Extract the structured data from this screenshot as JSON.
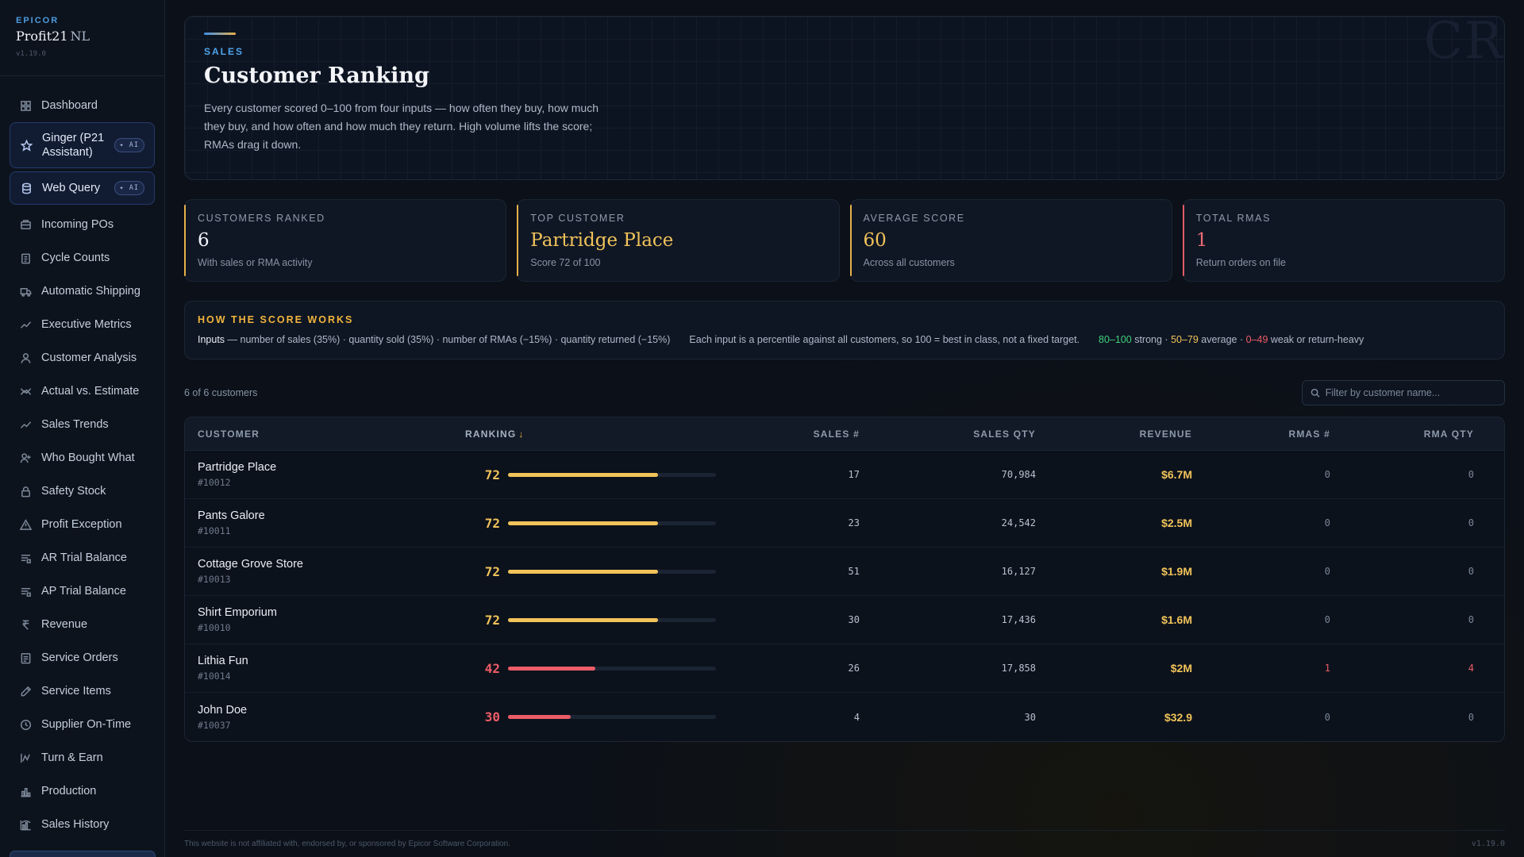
{
  "brand": {
    "vendor": "EPICOR",
    "name": "Profit21",
    "suffix": "NL",
    "version": "v1.19.0"
  },
  "sidebar": {
    "items": [
      {
        "label": "Dashboard",
        "icon": "dashboard-icon"
      },
      {
        "label": "Ginger (P21 Assistant)",
        "icon": "star-icon",
        "badge": "✦ AI"
      },
      {
        "label": "Web Query",
        "icon": "database-icon",
        "badge": "✦ AI"
      },
      {
        "label": "Incoming POs",
        "icon": "inbox-icon"
      },
      {
        "label": "Cycle Counts",
        "icon": "clipboard-icon"
      },
      {
        "label": "Automatic Shipping",
        "icon": "truck-icon"
      },
      {
        "label": "Executive Metrics",
        "icon": "trend-icon"
      },
      {
        "label": "Customer Analysis",
        "icon": "user-icon"
      },
      {
        "label": "Actual vs. Estimate",
        "icon": "compare-icon"
      },
      {
        "label": "Sales Trends",
        "icon": "trend-icon"
      },
      {
        "label": "Who Bought What",
        "icon": "user-plus-icon"
      },
      {
        "label": "Safety Stock",
        "icon": "lock-icon"
      },
      {
        "label": "Profit Exception",
        "icon": "warning-icon"
      },
      {
        "label": "AR Trial Balance",
        "icon": "ledger-icon"
      },
      {
        "label": "AP Trial Balance",
        "icon": "ledger-icon"
      },
      {
        "label": "Revenue",
        "icon": "currency-icon"
      },
      {
        "label": "Service Orders",
        "icon": "document-icon"
      },
      {
        "label": "Service Items",
        "icon": "pen-icon"
      },
      {
        "label": "Supplier On-Time",
        "icon": "clock-icon"
      },
      {
        "label": "Turn & Earn",
        "icon": "cycle-chart-icon"
      },
      {
        "label": "Production",
        "icon": "bar-chart-icon"
      },
      {
        "label": "Sales History",
        "icon": "history-chart-icon"
      }
    ]
  },
  "hero": {
    "kicker": "SALES",
    "title": "Customer Ranking",
    "description": "Every customer scored 0–100 from four inputs — how often they buy, how much they buy, and how often and how much they return. High volume lifts the score; RMAs drag it down.",
    "watermark": "CR"
  },
  "kpis": [
    {
      "label": "CUSTOMERS RANKED",
      "value": "6",
      "sub": "With sales or RMA activity"
    },
    {
      "label": "TOP CUSTOMER",
      "value": "Partridge Place",
      "sub": "Score 72 of 100"
    },
    {
      "label": "AVERAGE SCORE",
      "value": "60",
      "sub": "Across all customers"
    },
    {
      "label": "TOTAL RMAS",
      "value": "1",
      "sub": "Return orders on file"
    }
  ],
  "howto": {
    "title": "HOW THE SCORE WORKS",
    "inputs_label": "Inputs",
    "inputs_text": " — number of sales (35%) · quantity sold (35%) · number of RMAs (−15%) · quantity returned (−15%)",
    "note": "Each input is a percentile against all customers, so 100 = best in class, not a fixed target.",
    "legend": {
      "strong_range": "80–100",
      "strong_text": " strong · ",
      "avg_range": "50–79",
      "avg_text": " average · ",
      "weak_range": "0–49",
      "weak_text": " weak or return-heavy"
    }
  },
  "toolbar": {
    "count": "6 of 6 customers",
    "search_placeholder": "Filter by customer name..."
  },
  "table": {
    "headers": {
      "customer": "CUSTOMER",
      "ranking": "RANKING",
      "ranking_arrow": "↓",
      "sales": "SALES #",
      "qty": "SALES QTY",
      "revenue": "REVENUE",
      "rmas": "RMAS #",
      "rmaqty": "RMA QTY"
    },
    "rows": [
      {
        "name": "Partridge Place",
        "id": "#10012",
        "score": 72,
        "sales": "17",
        "qty": "70,984",
        "revenue": "$6.7M",
        "rmas": "0",
        "rmaqty": "0"
      },
      {
        "name": "Pants Galore",
        "id": "#10011",
        "score": 72,
        "sales": "23",
        "qty": "24,542",
        "revenue": "$2.5M",
        "rmas": "0",
        "rmaqty": "0"
      },
      {
        "name": "Cottage Grove Store",
        "id": "#10013",
        "score": 72,
        "sales": "51",
        "qty": "16,127",
        "revenue": "$1.9M",
        "rmas": "0",
        "rmaqty": "0"
      },
      {
        "name": "Shirt Emporium",
        "id": "#10010",
        "score": 72,
        "sales": "30",
        "qty": "17,436",
        "revenue": "$1.6M",
        "rmas": "0",
        "rmaqty": "0"
      },
      {
        "name": "Lithia Fun",
        "id": "#10014",
        "score": 42,
        "sales": "26",
        "qty": "17,858",
        "revenue": "$2M",
        "rmas": "1",
        "rmaqty": "4"
      },
      {
        "name": "John Doe",
        "id": "#10037",
        "score": 30,
        "sales": "4",
        "qty": "30",
        "revenue": "$32.9",
        "rmas": "0",
        "rmaqty": "0"
      }
    ]
  },
  "footer": {
    "disclaimer": "This website is not affiliated with, endorsed by, or sponsored by Epicor Software Corporation.",
    "version": "v1.19.0"
  },
  "colors": {
    "gold": "#f1c35a",
    "red": "#ec5c67",
    "green": "#3ed07a",
    "accent_blue": "#4ea4ec"
  }
}
